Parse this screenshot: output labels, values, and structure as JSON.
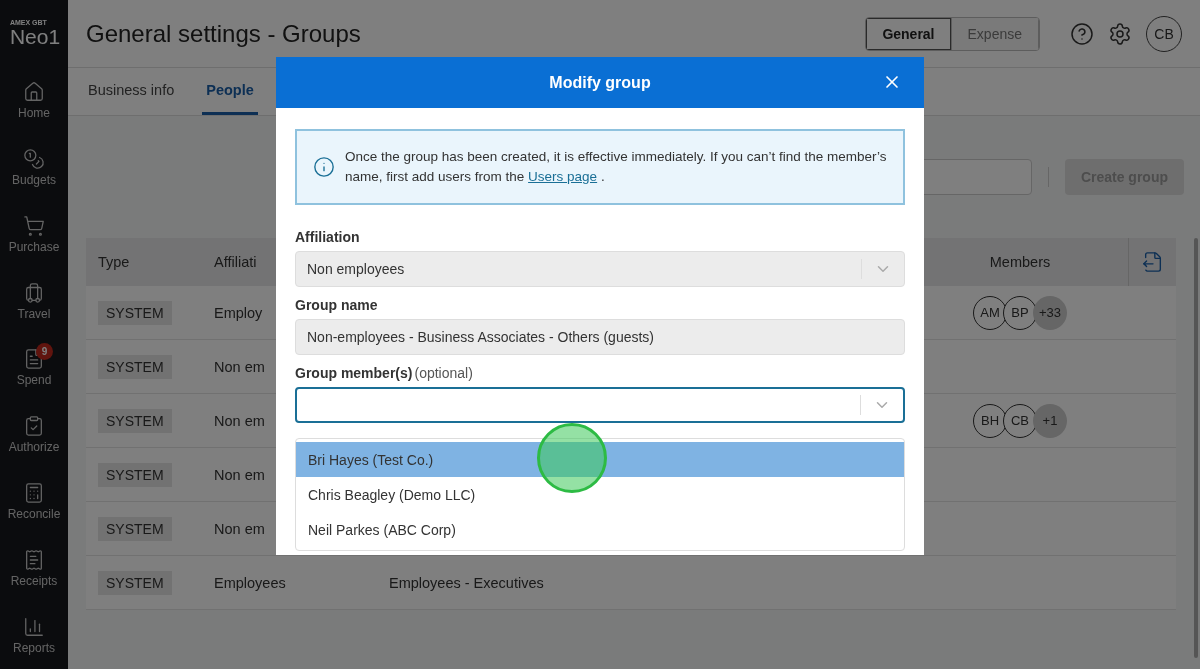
{
  "sidebar": {
    "logo": {
      "brand": "AMEX GBT",
      "product": "Neo1"
    },
    "items": [
      {
        "label": "Home"
      },
      {
        "label": "Budgets"
      },
      {
        "label": "Purchase"
      },
      {
        "label": "Travel"
      },
      {
        "label": "Spend",
        "badge": "9"
      },
      {
        "label": "Authorize"
      },
      {
        "label": "Reconcile"
      },
      {
        "label": "Receipts"
      },
      {
        "label": "Reports"
      }
    ]
  },
  "header": {
    "title": "General settings - Groups",
    "modes": [
      {
        "label": "General",
        "selected": true
      },
      {
        "label": "Expense",
        "selected": false
      }
    ],
    "avatar": "CB"
  },
  "tabs": [
    {
      "label": "Business info",
      "selected": false
    },
    {
      "label": "People",
      "selected": true
    }
  ],
  "toolbar": {
    "create_button": {
      "label": "Create group",
      "disabled": true
    }
  },
  "table": {
    "columns": [
      "Type",
      "Affiliati",
      "Members"
    ],
    "rows": [
      {
        "type": "SYSTEM",
        "affiliation": "Employ",
        "members": [
          "AM",
          "BP"
        ],
        "more": "+33"
      },
      {
        "type": "SYSTEM",
        "affiliation": "Non em"
      },
      {
        "type": "SYSTEM",
        "affiliation": "Non em",
        "members": [
          "BH",
          "CB"
        ],
        "more": "+1"
      },
      {
        "type": "SYSTEM",
        "affiliation": "Non em"
      },
      {
        "type": "SYSTEM",
        "affiliation": "Non em"
      },
      {
        "type": "SYSTEM",
        "affiliation": "Employees",
        "group_name": "Employees - Executives"
      }
    ]
  },
  "modal": {
    "title": "Modify group",
    "info": {
      "text": "Once the group has been created, it is effective immediately. If you can’t find the member’s name, first add users from the",
      "link": "Users page",
      "end": "."
    },
    "affiliation": {
      "label": "Affiliation",
      "value": "Non employees"
    },
    "group_name": {
      "label": "Group name",
      "value": "Non-employees - Business Associates - Others (guests)"
    },
    "members": {
      "label": "Group member(s)",
      "hint": "(optional)",
      "options": [
        {
          "label": "Bri Hayes (Test Co.)",
          "selected": true
        },
        {
          "label": "Chris Beagley (Demo LLC)",
          "selected": false
        },
        {
          "label": "Neil Parkes (ABC Corp)",
          "selected": false
        }
      ]
    }
  }
}
